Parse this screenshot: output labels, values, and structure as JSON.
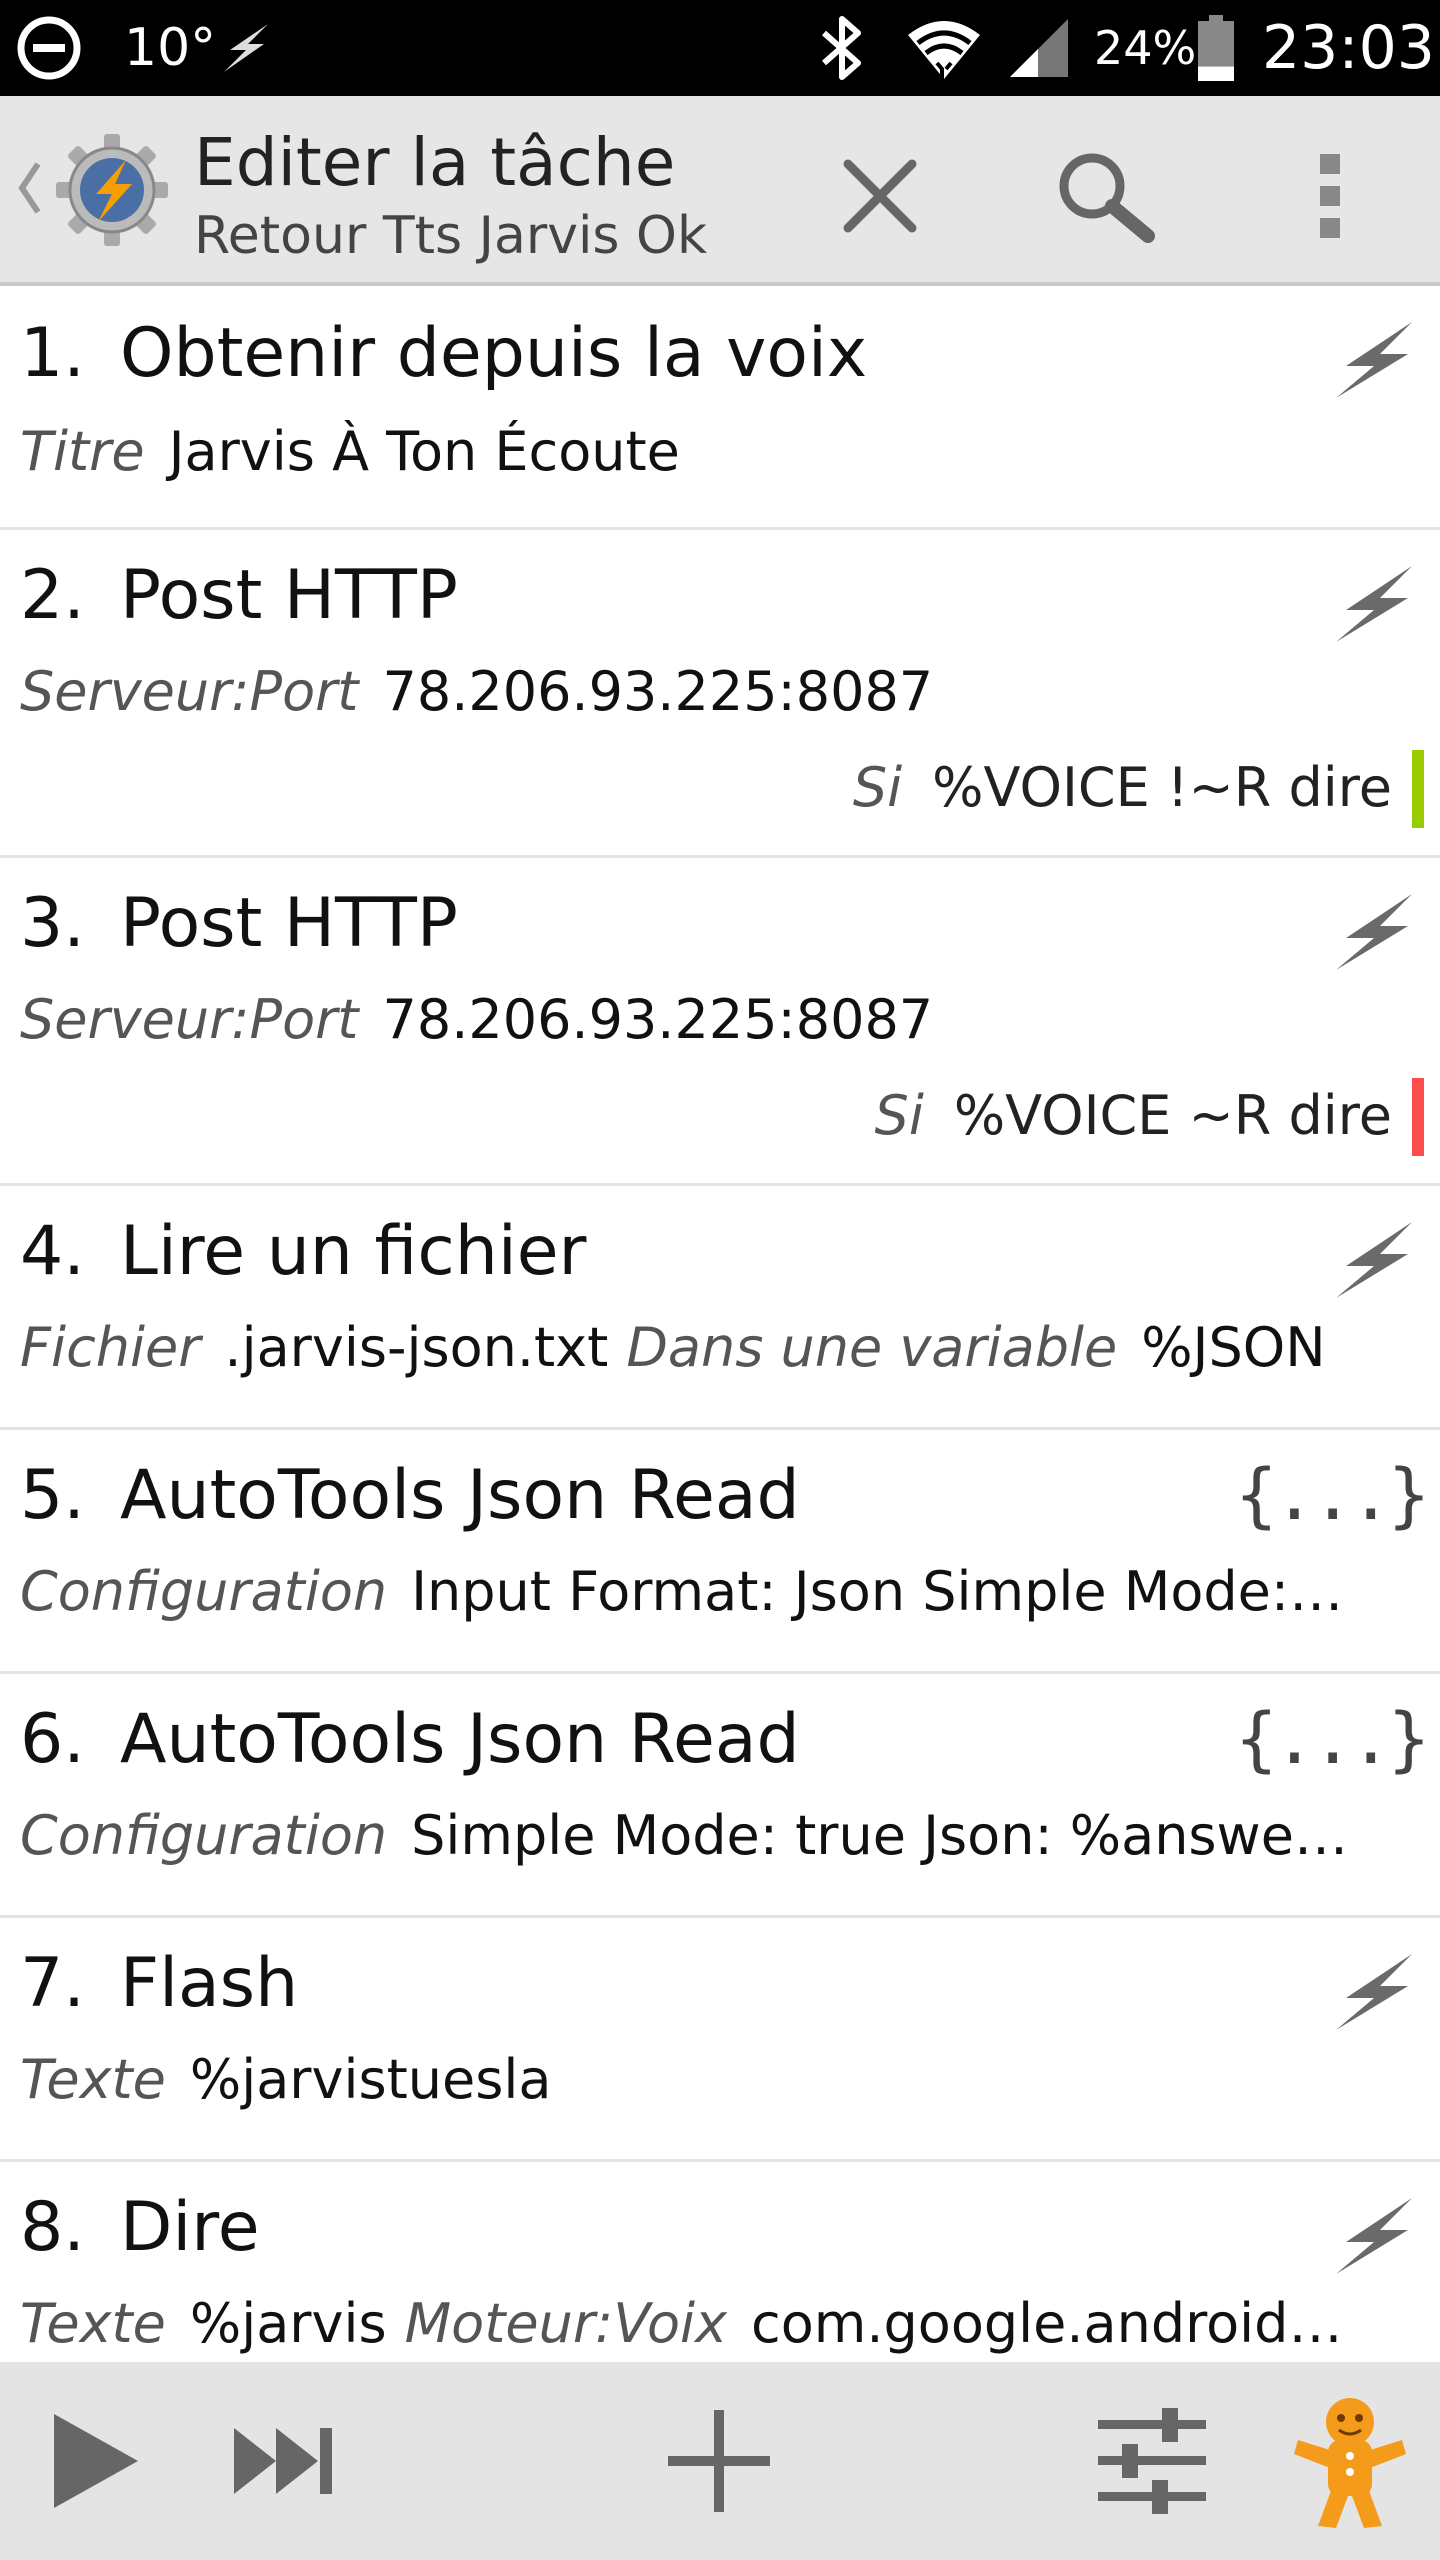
{
  "status_bar": {
    "temperature": "10°",
    "battery_percent": "24%",
    "battery_level": 0.24,
    "time": "23:03",
    "icons": [
      "do-not-disturb-icon",
      "flash-icon",
      "bluetooth-icon",
      "wifi-icon",
      "signal-icon",
      "battery-icon"
    ]
  },
  "header": {
    "title": "Editer la tâche",
    "subtitle": "Retour Tts Jarvis Ok",
    "icons": [
      "back-chevron-icon",
      "tasker-gear-icon",
      "close-icon",
      "search-icon",
      "overflow-menu-icon"
    ]
  },
  "actions": [
    {
      "num": "1.",
      "title": "Obtenir depuis la voix",
      "icon": "lightning-icon",
      "details": [
        {
          "label": "Titre",
          "value": "Jarvis À Ton Écoute"
        }
      ]
    },
    {
      "num": "2.",
      "title": "Post HTTP",
      "icon": "lightning-icon",
      "details": [
        {
          "label": "Serveur:Port",
          "value": "78.206.93.225:8087"
        }
      ],
      "condition": {
        "label": "Si",
        "value": "%VOICE !~R dire",
        "color": "#99cc00"
      }
    },
    {
      "num": "3.",
      "title": "Post HTTP",
      "icon": "lightning-icon",
      "details": [
        {
          "label": "Serveur:Port",
          "value": "78.206.93.225:8087"
        }
      ],
      "condition": {
        "label": "Si",
        "value": "%VOICE ~R dire",
        "color": "#ff4d4d"
      }
    },
    {
      "num": "4.",
      "title": "Lire un fichier",
      "icon": "lightning-icon",
      "details": [
        {
          "label": "Fichier",
          "value": ".jarvis-json.txt"
        },
        {
          "label": "Dans une variable",
          "value": "%JSON"
        }
      ]
    },
    {
      "num": "5.",
      "title": "AutoTools Json Read",
      "icon": "json-braces-icon",
      "icon_text": "{...}",
      "details": [
        {
          "label": "Configuration",
          "value": "Input Format: Json Simple Mode:..."
        }
      ]
    },
    {
      "num": "6.",
      "title": "AutoTools Json Read",
      "icon": "json-braces-icon",
      "icon_text": "{...}",
      "details": [
        {
          "label": "Configuration",
          "value": "Simple Mode: true Json: %answe..."
        }
      ]
    },
    {
      "num": "7.",
      "title": "Flash",
      "icon": "lightning-icon",
      "details": [
        {
          "label": "Texte",
          "value": "%jarvistuesla"
        }
      ]
    },
    {
      "num": "8.",
      "title": "Dire",
      "icon": "lightning-icon",
      "details": [
        {
          "label": "Texte",
          "value": "%jarvis"
        },
        {
          "label": "Moteur:Voix",
          "value": "com.google.android...."
        }
      ]
    }
  ],
  "bottom_bar": {
    "icons": [
      "play-icon",
      "step-forward-icon",
      "add-icon",
      "settings-sliders-icon",
      "gingerbread-man-icon"
    ]
  },
  "colors": {
    "status_bar": "#000000",
    "action_bar": "#e6e6e6",
    "bottom_bar": "#e4e4e4",
    "icon_grey": "#666666",
    "accent_orange": "#f59b1c",
    "condition_true": "#99cc00",
    "condition_false": "#ff4d4d"
  }
}
